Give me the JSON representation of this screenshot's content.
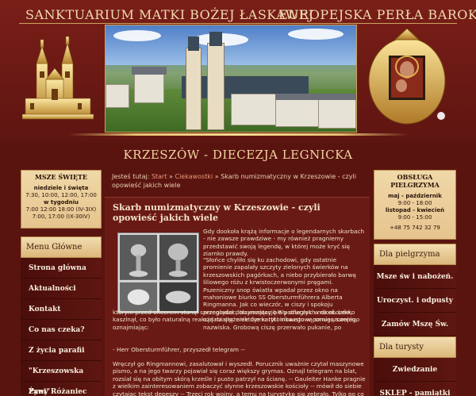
{
  "header": {
    "title_left": "SANKTUARIUM MATKI BOŻEJ ŁASKAWEJ",
    "title_right": "EUROPEJSKA PERŁA BAROKU",
    "subtitle": "KRZESZÓW - DIECEZJA LEGNICKA"
  },
  "mass_box": {
    "title": "MSZE ŚWIĘTE",
    "lines": [
      {
        "text": "niedziele i święta",
        "bold": true
      },
      {
        "text": "7:30, 10:00, 12:00, 17:00",
        "bold": false
      },
      {
        "text": "w tygodniu",
        "bold": true
      },
      {
        "text": "7:00 12:00 18:00 (IV-3IX)",
        "bold": false
      },
      {
        "text": "7:00, 17:00 (IX-30IV)",
        "bold": false
      }
    ]
  },
  "left_menu": {
    "heading": "Menu Główne",
    "items": [
      "Strona główna",
      "Aktualności",
      "Kontakt",
      "Co nas czeka?",
      "Z życia parafii",
      "\"Krzeszowska Pani\"",
      "Żywy Różaniec"
    ]
  },
  "breadcrumb": {
    "prefix": "Jesteś tutaj:",
    "items": [
      "Start",
      "Ciekawostki"
    ],
    "separator": "»",
    "current": "Skarb numizmatyczny w Krzeszowie - czyli opowieść jakich wiele"
  },
  "article": {
    "title": "Skarb numizmatyczny w Krzeszowie - czyli opowieść jakich wiele",
    "para1": "Gdy dookoła krążą informacje o legendarnych skarbach - nie zawsze prawdziwe - my również pragniemy przedstawić swoją legendę, w której może kryć się ziarnko prawdy.",
    "para2": "\"Słońce chyliło się ku zachodowi, gdy ostatnie promienie zapalały szczyty zielonych świerków na krzeszowskich pagórkach, a niebo przybierało barwę liliowego różu z krwistoczerwonymi pręgami. Pszeniczny snop światła wpadał przez okno na mahoniowe biurko SS Obersturmführera Alberta Ringmanna. Jak co wieczór, w ciszy i spokoju przeglądał dokumentację 6 podległych mu obozów, ozdabiając niektóre kartki inkaustową smugą swojego nazwiska. Grobową ciszę przerwało pukanie, po",
    "para3": "którym przed oficerem stanął szeregowiec, trzymający biały druczek w dłoni. Lekko kaszlnął, co było naturalną reakcją na stężenie dymu tytoniowego w pomieszczeniu, oznajmiając:",
    "para4": "- Herr Obersturmführer, przyszedł telegram --",
    "para5": "Wręczył go Ringmannowi, zasalutował i wyszedł. Porucznik uważnie czytał maszynowe pismo, a na jego twarzy pojawiał się coraz większy grymas. Oznajl telegram na blat, rozsiał się na obitym skórą krześle i pusto patrzył na ścianę. -- Gauleiter Hanke pragnie z wielkim zainteresowaniem zobaczyć słynne krzeszowskie kościoły -- mówił do siebie czytając tekst depeszy -- Trzeci rok wojny, a temu na turystykę się zebrało. Tylko po co bierze ze sobą"
  },
  "pilgrim_box": {
    "title": "OBSŁUGA PIELGRZYMA",
    "lines": [
      {
        "text": "maj - październik",
        "bold": true
      },
      {
        "text": "9:00 - 18:00",
        "bold": false
      },
      {
        "text": "listopad - kwiecień",
        "bold": true
      },
      {
        "text": "9:00 - 15:00",
        "bold": false
      },
      {
        "text": "",
        "bold": false
      },
      {
        "text": "+48 75 742 32 79",
        "bold": false
      }
    ]
  },
  "right_menu_pilgrims": {
    "heading": "Dla pielgrzyma",
    "items": [
      "Msze św i nabożeń.",
      "Uroczyst. i odpusty",
      "Zamów Mszę Św."
    ]
  },
  "right_menu_tourists": {
    "heading": "Dla turysty",
    "items": [
      "Zwiedzanie",
      "SKLEP - pamiątki"
    ]
  }
}
